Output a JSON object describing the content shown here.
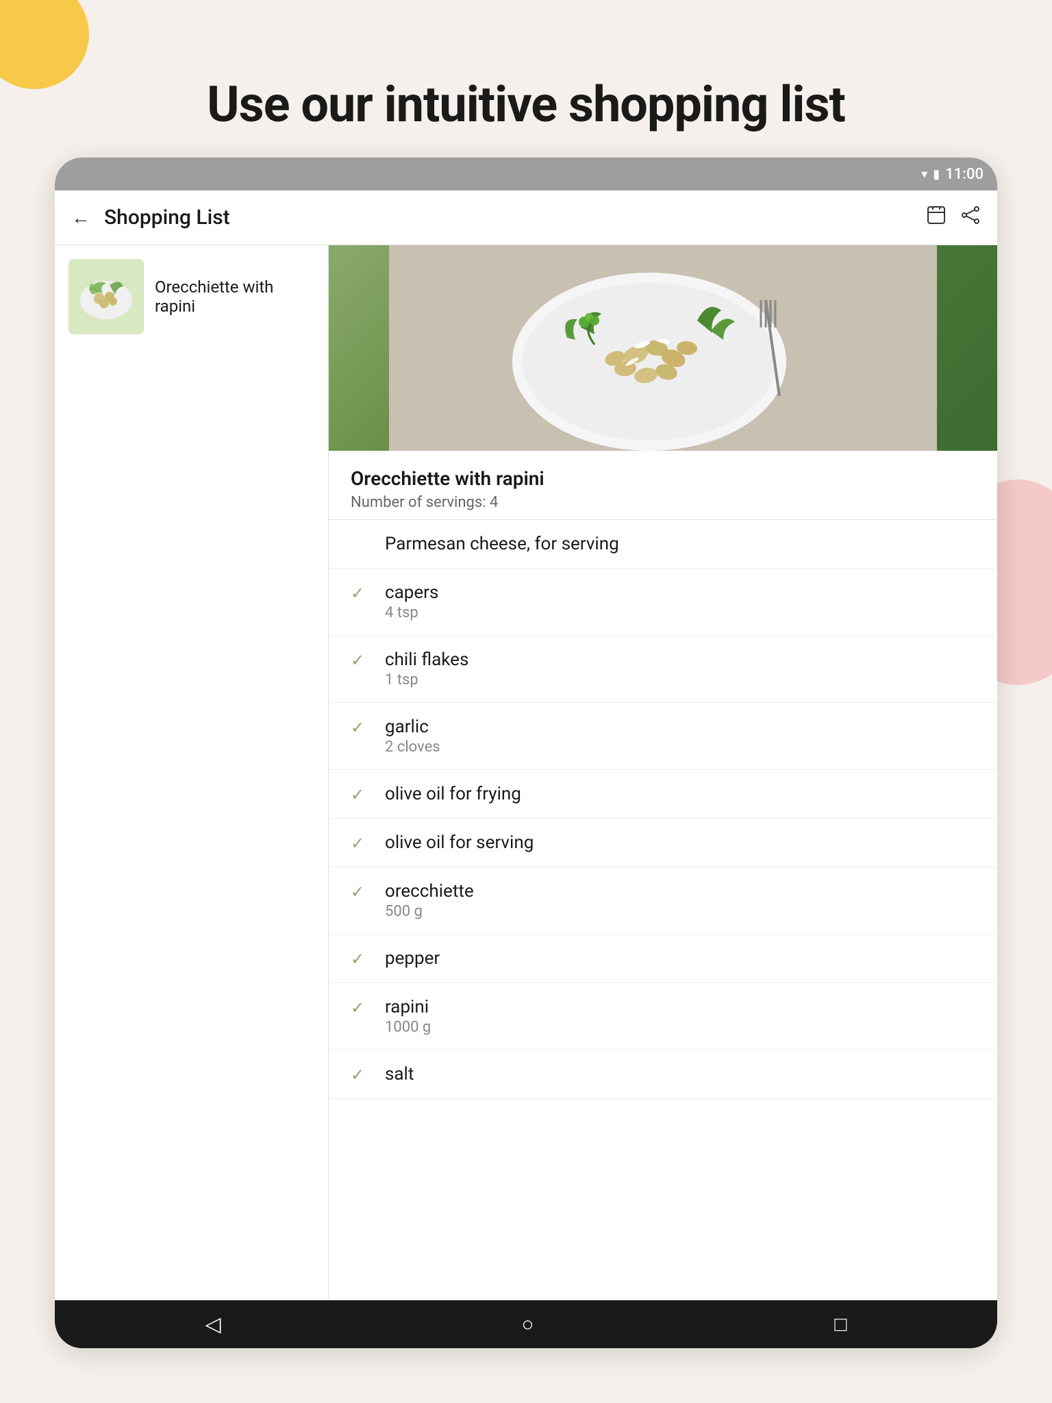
{
  "page": {
    "heading": "Use our intuitive shopping list"
  },
  "status_bar": {
    "time": "11:00"
  },
  "toolbar": {
    "title": "Shopping List"
  },
  "recipe": {
    "name": "Orecchiette with rapini",
    "servings_label": "Number of servings: 4"
  },
  "ingredients": [
    {
      "name": "Parmesan cheese, for serving",
      "amount": "",
      "checked": false
    },
    {
      "name": "capers",
      "amount": "4 tsp",
      "checked": true
    },
    {
      "name": "chili flakes",
      "amount": "1 tsp",
      "checked": true
    },
    {
      "name": "garlic",
      "amount": "2 cloves",
      "checked": true
    },
    {
      "name": "olive oil for frying",
      "amount": "",
      "checked": true
    },
    {
      "name": "olive oil for serving",
      "amount": "",
      "checked": true
    },
    {
      "name": "orecchiette",
      "amount": "500 g",
      "checked": true
    },
    {
      "name": "pepper",
      "amount": "",
      "checked": true
    },
    {
      "name": "rapini",
      "amount": "1000 g",
      "checked": true
    },
    {
      "name": "salt",
      "amount": "",
      "checked": true
    }
  ],
  "nav": {
    "back": "‹",
    "home": "○",
    "recent": "□"
  },
  "icons": {
    "back_arrow": "←",
    "timer": "⊙",
    "share": "⇗",
    "check": "✓"
  }
}
